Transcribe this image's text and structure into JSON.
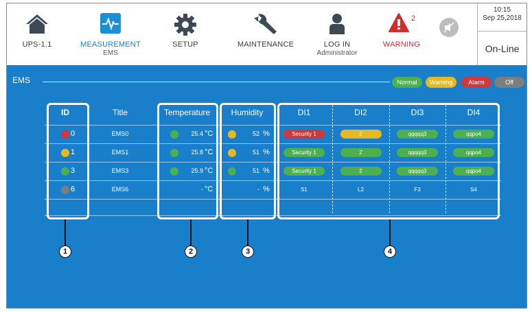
{
  "nav": {
    "ups": {
      "label": "UPS-1.1"
    },
    "measurement": {
      "label": "MEASUREMENT",
      "sub": "EMS"
    },
    "setup": {
      "label": "SETUP"
    },
    "maintenance": {
      "label": "MAINTENANCE"
    },
    "login": {
      "label": "LOG IN",
      "sub": "Administrator"
    },
    "warning": {
      "label": "WARNING",
      "count": "2"
    }
  },
  "clock": {
    "time": "10:15",
    "date": "Sep 25,2018",
    "status": "On-Line"
  },
  "section": {
    "title": "EMS"
  },
  "legend": [
    {
      "label": "Normal",
      "color": "#4caf50"
    },
    {
      "label": "Warning",
      "color": "#e8b820"
    },
    {
      "label": "Alarm",
      "color": "#d0383b"
    },
    {
      "label": "Off",
      "color": "#7d7d7d"
    }
  ],
  "table": {
    "headers": {
      "id": "ID",
      "title": "Title",
      "temperature": "Temperature",
      "humidity": "Humidity",
      "di1": "DI1",
      "di2": "DI2",
      "di3": "DI3",
      "di4": "DI4"
    },
    "rows": [
      {
        "status_color": "#d0383b",
        "id": "0",
        "title": "EMS0",
        "temp_color": "#4caf50",
        "temp": "25.4",
        "temp_unit": "°C",
        "hum_color": "#e8b820",
        "hum": "52",
        "hum_unit": "%",
        "di1": "Security 1",
        "di1_color": "#d0383b",
        "di2": "2",
        "di2_color": "#e8b820",
        "di3": "qqqqq3",
        "di3_color": "#4caf50",
        "di4": "qqpo4",
        "di4_color": "#4caf50"
      },
      {
        "status_color": "#e8b820",
        "id": "1",
        "title": "EMS1",
        "temp_color": "#4caf50",
        "temp": "25.8",
        "temp_unit": "°C",
        "hum_color": "#e8b820",
        "hum": "51",
        "hum_unit": "%",
        "di1": "Security 1",
        "di1_color": "#4caf50",
        "di2": "2",
        "di2_color": "#4caf50",
        "di3": "qqqqq3",
        "di3_color": "#4caf50",
        "di4": "qqpo4",
        "di4_color": "#4caf50"
      },
      {
        "status_color": "#4caf50",
        "id": "3",
        "title": "EMS3",
        "temp_color": "#4caf50",
        "temp": "25.9",
        "temp_unit": "°C",
        "hum_color": "#4caf50",
        "hum": "51",
        "hum_unit": "%",
        "di1": "Security 1",
        "di1_color": "#4caf50",
        "di2": "2",
        "di2_color": "#4caf50",
        "di3": "qqqqq3",
        "di3_color": "#4caf50",
        "di4": "qqpo4",
        "di4_color": "#4caf50"
      },
      {
        "status_color": "#7d7d7d",
        "id": "6",
        "title": "EMS6",
        "temp_color": "",
        "temp": "-",
        "temp_unit": "°C",
        "hum_color": "",
        "hum": "-",
        "hum_unit": "%",
        "di1": "S1",
        "di1_color": "",
        "di2": "L2",
        "di2_color": "",
        "di3": "F3",
        "di3_color": "",
        "di4": "S4",
        "di4_color": ""
      }
    ]
  },
  "callouts": [
    "1",
    "2",
    "3",
    "4"
  ]
}
